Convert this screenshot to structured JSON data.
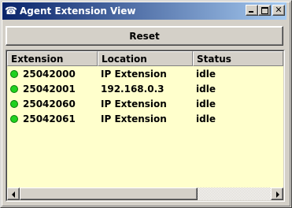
{
  "window": {
    "title": "Agent Extension View",
    "icon": "telephone-icon",
    "controls": [
      "minimize",
      "maximize",
      "close"
    ]
  },
  "toolbar": {
    "reset_label": "Reset"
  },
  "table": {
    "columns": [
      "Extension",
      "Location",
      "Status"
    ],
    "rows": [
      {
        "extension": "25042000",
        "location": "IP Extension",
        "status": "idle",
        "indicator": "green-dot"
      },
      {
        "extension": "25042001",
        "location": "192.168.0.3",
        "status": "idle",
        "indicator": "green-dot"
      },
      {
        "extension": "25042060",
        "location": "IP Extension",
        "status": "idle",
        "indicator": "green-dot"
      },
      {
        "extension": "25042061",
        "location": "IP Extension",
        "status": "idle",
        "indicator": "green-dot"
      }
    ],
    "background_color": "#ffffcc",
    "indicator_color": "#1fd21f"
  },
  "colors": {
    "titlebar_start": "#0a246a",
    "titlebar_end": "#a6caf0",
    "chrome": "#d4d0c8"
  }
}
